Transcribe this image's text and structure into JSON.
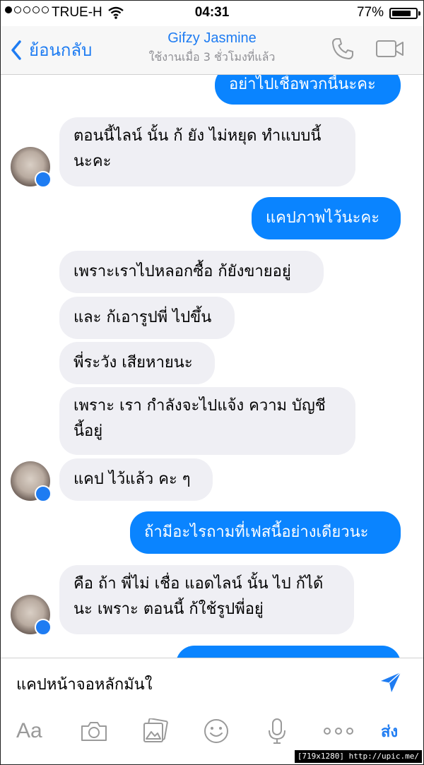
{
  "status": {
    "carrier": "TRUE-H",
    "time": "04:31",
    "battery": "77%",
    "battery_level": 0.77
  },
  "header": {
    "back_label": "ย้อนกลับ",
    "contact_name": "Gifzy Jasmine",
    "last_active": "ใช้งานเมื่อ 3 ชั่วโมงที่แล้ว"
  },
  "messages": [
    {
      "dir": "out",
      "text": "อย่าไปเชื่อพวกนี้นะคะ"
    },
    {
      "dir": "in",
      "text": "ตอนนี้ไลน์ นั้น ก้ ยัง ไม่หยุด ทำแบบนี้\nนะคะ"
    },
    {
      "dir": "out",
      "text": "แคปภาพไว้นะคะ"
    },
    {
      "dir": "in",
      "text": "เพราะเราไปหลอกซื้อ ก้ยังขายอยู่"
    },
    {
      "dir": "in",
      "text": "และ ก้เอารูปพี่ ไปขึ้น"
    },
    {
      "dir": "in",
      "text": "พี่ระวัง เสียหายนะ"
    },
    {
      "dir": "in",
      "text": "เพราะ เรา กำลังจะไปแจ้ง ความ บัญชี\nนี้อยู่"
    },
    {
      "dir": "in",
      "text": "แคป ไว้แล้ว คะ ๆ"
    },
    {
      "dir": "out",
      "text": "ถ้ามีอะไรถามที่เฟสนี้อย่างเดียวนะ"
    },
    {
      "dir": "in",
      "text": "คือ ถ้า พี่ไม่ เชื่อ แอดไลน์ นั้น ไป ก้ได้\nนะ เพราะ ตอนนี้ ก้ใช้รูปพี่อยู่"
    }
  ],
  "composer": {
    "value": "แคปหน้าจอหลักมันใ"
  },
  "toolbar": {
    "text_format_label": "Aa",
    "send_label": "ส่ง"
  },
  "colors": {
    "accent": "#1e7cf2",
    "outgoing_bubble": "#0a84ff",
    "incoming_bubble": "#efeff4"
  },
  "icons": [
    "back-chevron-icon",
    "phone-icon",
    "video-icon",
    "send-arrow-icon",
    "camera-icon",
    "photo-gallery-icon",
    "smiley-icon",
    "microphone-icon",
    "more-dots-icon",
    "messenger-badge-icon"
  ],
  "watermark": "[719x1280] http://upic.me/"
}
